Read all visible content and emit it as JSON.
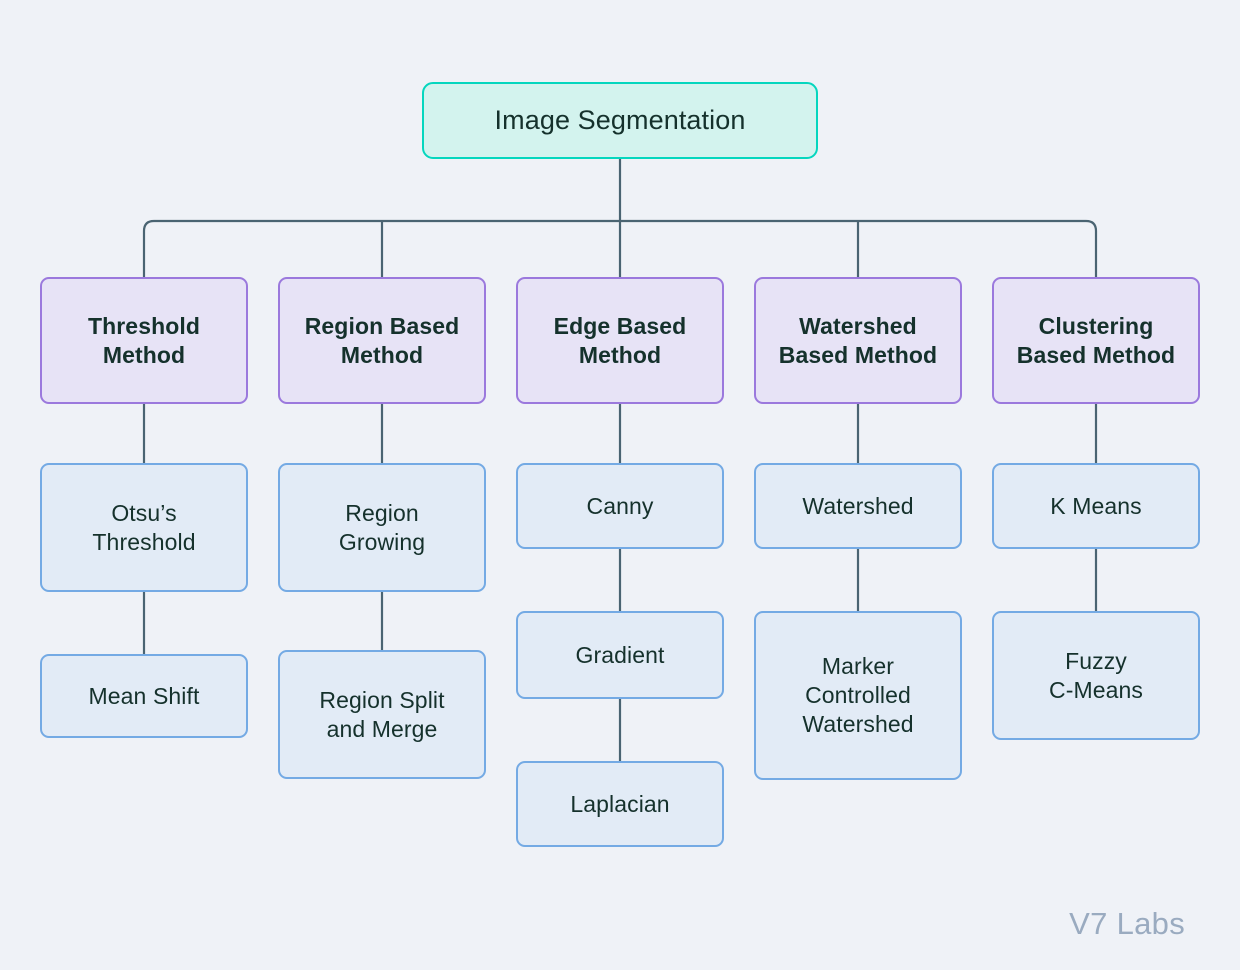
{
  "diagram": {
    "title": "Image Segmentation",
    "background_color": "#eff2f7",
    "connector_color": "#4a6472",
    "root": {
      "label": "Image Segmentation",
      "fill": "#d3f3ee",
      "border": "#05d6be"
    },
    "level2_style": {
      "fill": "#e7e3f6",
      "border": "#9b79dd"
    },
    "level3_style": {
      "fill": "#e2ebf6",
      "border": "#74aae4"
    },
    "branches": [
      {
        "label": "Threshold\nMethod",
        "children": [
          {
            "label": "Otsu’s\nThreshold"
          },
          {
            "label": "Mean Shift"
          }
        ]
      },
      {
        "label": "Region Based\nMethod",
        "children": [
          {
            "label": "Region\nGrowing"
          },
          {
            "label": "Region Split\nand Merge"
          }
        ]
      },
      {
        "label": "Edge Based\nMethod",
        "children": [
          {
            "label": "Canny"
          },
          {
            "label": "Gradient"
          },
          {
            "label": "Laplacian"
          }
        ]
      },
      {
        "label": "Watershed\nBased Method",
        "children": [
          {
            "label": "Watershed"
          },
          {
            "label": "Marker\nControlled\nWatershed"
          }
        ]
      },
      {
        "label": "Clustering\nBased Method",
        "children": [
          {
            "label": "K Means"
          },
          {
            "label": "Fuzzy\nC-Means"
          }
        ]
      }
    ]
  },
  "watermark": {
    "text": "V7 Labs"
  }
}
